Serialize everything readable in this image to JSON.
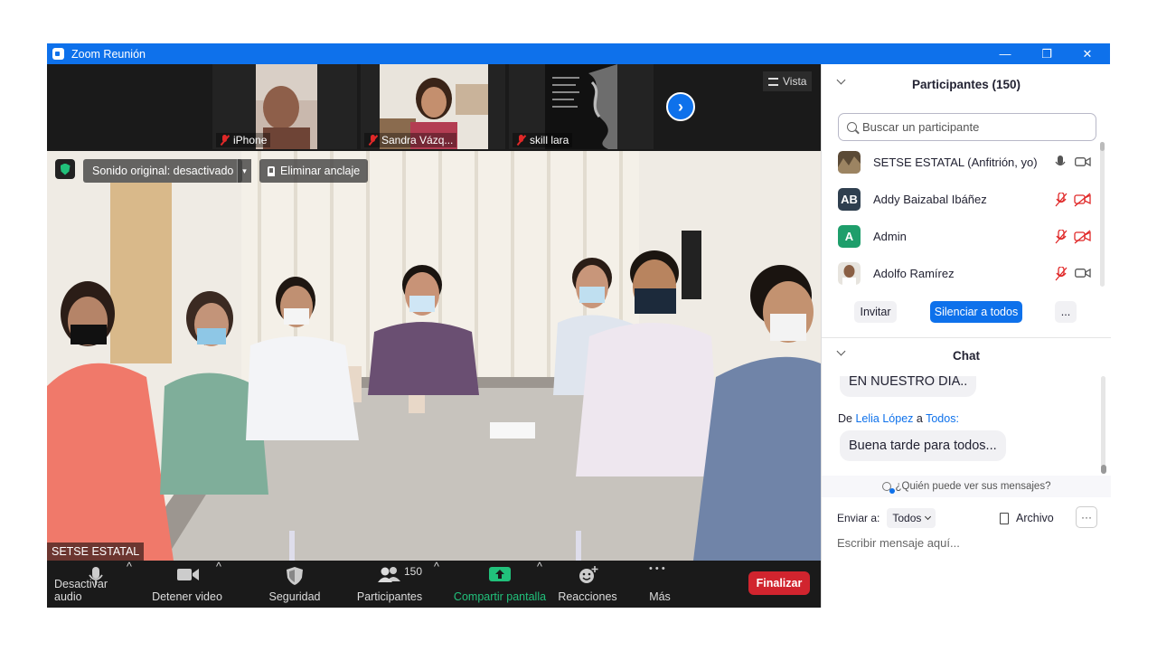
{
  "window": {
    "title": "Zoom Reunión",
    "minimize_glyph": "—",
    "restore_glyph": "❐",
    "close_glyph": "✕"
  },
  "thumbnails": [
    {
      "name": "iPhone",
      "muted": true
    },
    {
      "name": "Sandra Vázq...",
      "muted": true
    },
    {
      "name": "skill lara",
      "muted": true
    }
  ],
  "strip": {
    "next_glyph": "›",
    "view_label": "Vista"
  },
  "speaker": {
    "sound_label": "Sonido original: desactivado",
    "caret_glyph": "▾",
    "unpin_label": "Eliminar anclaje",
    "name": "SETSE ESTATAL"
  },
  "toolbar": {
    "audio": "Desactivar audio",
    "video": "Detener video",
    "security": "Seguridad",
    "participants": "Participantes",
    "participants_count": "150",
    "share": "Compartir pantalla",
    "reactions": "Reacciones",
    "more": "Más",
    "more_glyph": "• • •",
    "end": "Finalizar",
    "caret_glyph": "^"
  },
  "participants_panel": {
    "title": "Participantes (150)",
    "search_placeholder": "Buscar un participante",
    "list": [
      {
        "name": "SETSE ESTATAL (Anfitrión, yo)",
        "initials": "",
        "avatar_color": "#6b5a3e",
        "mic": "on",
        "video": "off"
      },
      {
        "name": "Addy Baizabal Ibáñez",
        "initials": "AB",
        "avatar_color": "#2f3f4f",
        "mic": "muted",
        "video": "stopped"
      },
      {
        "name": "Admin",
        "initials": "A",
        "avatar_color": "#1e9e6b",
        "mic": "muted",
        "video": "stopped"
      },
      {
        "name": "Adolfo Ramírez",
        "initials": "",
        "avatar_color": "#8a6a4f",
        "mic": "muted",
        "video": "off"
      }
    ],
    "invite": "Invitar",
    "mute_all": "Silenciar a todos",
    "more": "..."
  },
  "chat": {
    "title": "Chat",
    "prev_message": "EN NUESTRO DIA..",
    "from_prefix": "De",
    "from_name": "Lelia López",
    "to_word": "a",
    "to_name": "Todos:",
    "message": "Buena tarde para todos...",
    "who_can_see": "¿Quién puede ver sus mensajes?",
    "send_to_label": "Enviar a:",
    "send_to_value": "Todos",
    "file_label": "Archivo",
    "more": "···",
    "input_placeholder": "Escribir mensaje aquí..."
  },
  "colors": {
    "zoom_blue": "#0e71eb",
    "end_red": "#d1242e",
    "share_green": "#21c17b",
    "muted_red": "#e02828"
  }
}
